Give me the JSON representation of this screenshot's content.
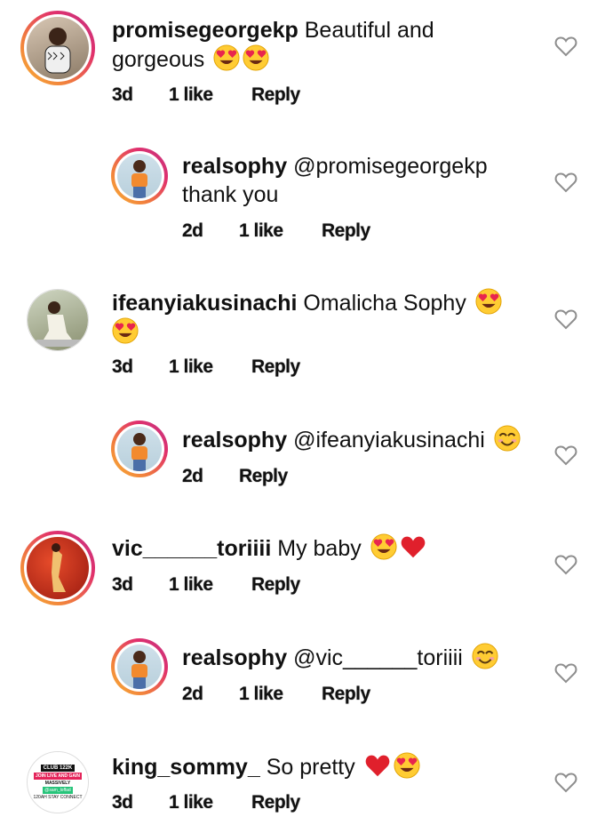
{
  "comments": [
    {
      "username": "promisegeorgekp",
      "text": "Beautiful and",
      "text_line2": "gorgeous",
      "emojis": [
        "heart-eyes",
        "heart-eyes"
      ],
      "time": "3d",
      "likes": "1 like",
      "reply": "Reply"
    },
    {
      "username": "realsophy",
      "text": "@promisegeorgekp",
      "text_line2": "thank you",
      "time": "2d",
      "likes": "1 like",
      "reply": "Reply"
    },
    {
      "username": "ifeanyiakusinachi",
      "text": "Omalicha Sophy",
      "emojis": [
        "heart-eyes",
        "heart-eyes"
      ],
      "time": "3d",
      "likes": "1 like",
      "reply": "Reply"
    },
    {
      "username": "realsophy",
      "text": "@ifeanyiakusinachi",
      "emojis": [
        "smiling-eyes"
      ],
      "time": "2d",
      "reply": "Reply"
    },
    {
      "username": "vic______toriiii",
      "text": "My baby",
      "emojis": [
        "heart-eyes",
        "red-heart"
      ],
      "time": "3d",
      "likes": "1 like",
      "reply": "Reply"
    },
    {
      "username": "realsophy",
      "text": "@vic______toriiii",
      "emojis": [
        "smiling-eyes"
      ],
      "time": "2d",
      "likes": "1 like",
      "reply": "Reply"
    },
    {
      "username": "king_sommy_",
      "text": "So pretty",
      "emojis": [
        "red-heart",
        "heart-eyes"
      ],
      "time": "3d",
      "likes": "1 like",
      "reply": "Reply",
      "avatar_text": [
        "CLUB 122K",
        "JOIN LIVE AND GAIN",
        "MASSIVELY",
        "@sam_loffad",
        "120AH STAY CONNECT"
      ]
    }
  ],
  "like_icon": "heart-outline-icon"
}
